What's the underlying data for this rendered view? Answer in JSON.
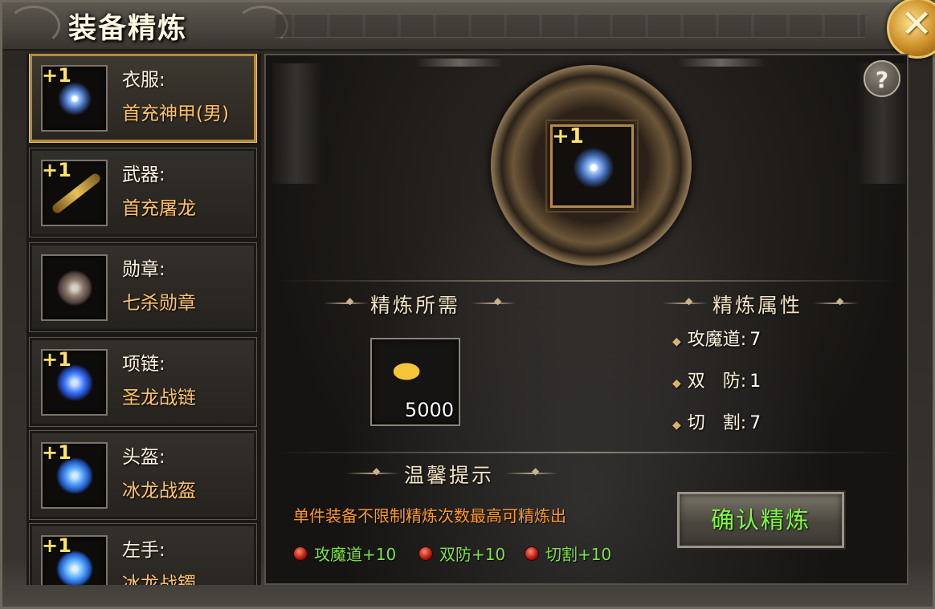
{
  "window": {
    "title": "装备精炼",
    "close_icon": "close-x-icon",
    "help_label": "?"
  },
  "equipment_list": [
    {
      "level": "+1",
      "category": "衣服:",
      "name": "首充神甲(男)",
      "icon": "armor-icon",
      "selected": true
    },
    {
      "level": "+1",
      "category": "武器:",
      "name": "首充屠龙",
      "icon": "sword-icon",
      "selected": false
    },
    {
      "level": "",
      "category": "勋章:",
      "name": "七杀勋章",
      "icon": "medal-icon",
      "selected": false
    },
    {
      "level": "+1",
      "category": "项链:",
      "name": "圣龙战链",
      "icon": "necklace-icon",
      "selected": false
    },
    {
      "level": "+1",
      "category": "头盔:",
      "name": "冰龙战盔",
      "icon": "helmet-icon",
      "selected": false
    },
    {
      "level": "+1",
      "category": "左手:",
      "name": "冰龙战镯",
      "icon": "bracelet-icon",
      "selected": false
    }
  ],
  "selected_item": {
    "level": "+1",
    "icon": "armor-icon"
  },
  "requirement": {
    "title": "精炼所需",
    "amount": "5000",
    "icon": "gold-ingot-icon"
  },
  "attributes": {
    "title": "精炼属性",
    "items": [
      {
        "label": "攻魔道:",
        "value": "7"
      },
      {
        "label": "双　防:",
        "value": "1"
      },
      {
        "label": "切　割:",
        "value": "7"
      }
    ]
  },
  "tips": {
    "title": "温馨提示",
    "text": "单件装备不限制精炼次数最高可精炼出",
    "bonuses": [
      "攻魔道+10",
      "双防+10",
      "切割+10"
    ]
  },
  "confirm_label": "确认精炼",
  "colors": {
    "gold": "#ffc26a",
    "green": "#7ee34a",
    "orange": "#ff9a2a",
    "accent": "#b38a3c"
  }
}
